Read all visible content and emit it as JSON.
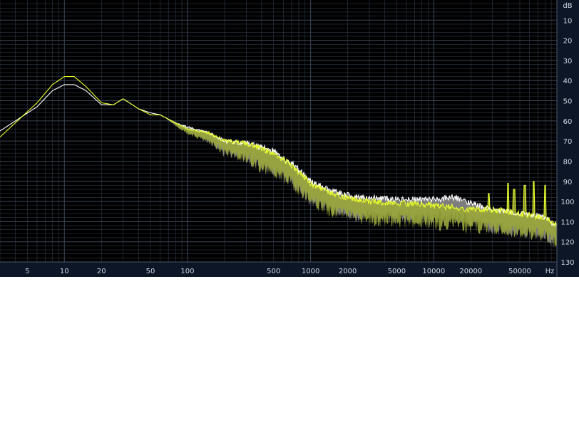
{
  "chart_data": {
    "type": "area",
    "x_scale": "log",
    "xlim": [
      3,
      100000
    ],
    "ylim": [
      0,
      130
    ],
    "y_inverted": true,
    "grid": true,
    "y_unit_label": "dB",
    "x_unit_label": "Hz",
    "x_ticks": [
      {
        "value": 5,
        "label": "5"
      },
      {
        "value": 10,
        "label": "10"
      },
      {
        "value": 20,
        "label": "20"
      },
      {
        "value": 50,
        "label": "50"
      },
      {
        "value": 100,
        "label": "100"
      },
      {
        "value": 500,
        "label": "500"
      },
      {
        "value": 1000,
        "label": "1000"
      },
      {
        "value": 2000,
        "label": "2000"
      },
      {
        "value": 5000,
        "label": "5000"
      },
      {
        "value": 10000,
        "label": "10000"
      },
      {
        "value": 20000,
        "label": "20000"
      },
      {
        "value": 50000,
        "label": "50000"
      }
    ],
    "y_ticks": [
      {
        "value": 10,
        "label": "10"
      },
      {
        "value": 20,
        "label": "20"
      },
      {
        "value": 30,
        "label": "30"
      },
      {
        "value": 40,
        "label": "40"
      },
      {
        "value": 50,
        "label": "50"
      },
      {
        "value": 60,
        "label": "60"
      },
      {
        "value": 70,
        "label": "70"
      },
      {
        "value": 80,
        "label": "80"
      },
      {
        "value": 90,
        "label": "90"
      },
      {
        "value": 100,
        "label": "100"
      },
      {
        "value": 110,
        "label": "110"
      },
      {
        "value": 120,
        "label": "120"
      },
      {
        "value": 130,
        "label": "130"
      }
    ],
    "series": [
      {
        "color": "#e9ff2a",
        "fill_color": "#9aa63a",
        "noise_band": 9,
        "x": [
          3,
          6,
          8,
          10,
          12,
          15,
          20,
          25,
          30,
          40,
          50,
          60,
          80,
          100,
          150,
          200,
          300,
          500,
          700,
          1000,
          1500,
          2000,
          3000,
          5000,
          8000,
          10000,
          15000,
          20000,
          30000,
          50000,
          80000,
          100000
        ],
        "y": [
          68,
          51,
          42,
          38,
          38,
          43,
          51,
          52,
          49,
          54,
          57,
          57,
          61,
          64,
          66,
          70,
          71,
          76,
          82,
          91,
          96,
          98,
          100,
          101,
          101,
          102,
          103,
          104,
          104,
          106,
          108,
          112
        ]
      },
      {
        "color": "#ffffff",
        "fill_color": "#8a8a8a",
        "noise_band": 9,
        "x": [
          3,
          6,
          8,
          10,
          12,
          15,
          20,
          25,
          30,
          40,
          50,
          60,
          80,
          100,
          150,
          200,
          300,
          500,
          700,
          1000,
          1500,
          2000,
          3000,
          5000,
          8000,
          10000,
          15000,
          20000,
          30000,
          50000,
          80000,
          100000
        ],
        "y": [
          65,
          53,
          45,
          42,
          42,
          45,
          52,
          52,
          49,
          54,
          56,
          57,
          61,
          63,
          66,
          70,
          71,
          75,
          81,
          90,
          95,
          97,
          98,
          99,
          99,
          99,
          98,
          101,
          104,
          106,
          108,
          112
        ]
      }
    ],
    "peaks": [
      {
        "x": 40000,
        "y": 91
      },
      {
        "x": 45000,
        "y": 94
      },
      {
        "x": 55000,
        "y": 92
      },
      {
        "x": 65000,
        "y": 90
      },
      {
        "x": 80000,
        "y": 92
      },
      {
        "x": 28000,
        "y": 96
      }
    ]
  },
  "colors": {
    "background": "#000000",
    "grid": "#303a48",
    "grid_major": "#3c4858",
    "axis_panel": "#0d1626",
    "axis_text": "#cfd6e2"
  }
}
